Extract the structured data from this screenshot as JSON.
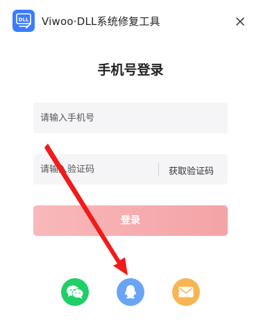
{
  "app": {
    "title": "Viwoo·DLL系统修复工具",
    "logo_text": "DLL"
  },
  "login": {
    "heading": "手机号登录",
    "phone_placeholder": "请输入手机号",
    "code_placeholder": "请输入验证码",
    "get_code_label": "获取验证码",
    "submit_label": "登录"
  },
  "social_login": [
    {
      "icon": "wechat-icon",
      "color": "#1fcf67"
    },
    {
      "icon": "qq-icon",
      "color": "#6aa4f5"
    },
    {
      "icon": "mail-icon",
      "color": "#f8b553"
    }
  ],
  "colors": {
    "accent": "#f4a3a6",
    "annotation_arrow": "#f21a1a"
  }
}
